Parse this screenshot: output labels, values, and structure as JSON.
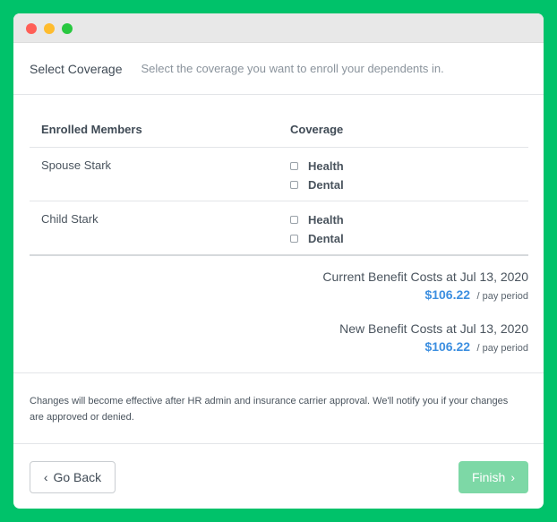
{
  "header": {
    "title": "Select Coverage",
    "subtitle": "Select the coverage you want to enroll your dependents in."
  },
  "table": {
    "headers": [
      "Enrolled Members",
      "Coverage"
    ],
    "rows": [
      {
        "member": "Spouse Stark",
        "options": [
          {
            "label": "Health",
            "checked": false
          },
          {
            "label": "Dental",
            "checked": false
          }
        ]
      },
      {
        "member": "Child Stark",
        "options": [
          {
            "label": "Health",
            "checked": false
          },
          {
            "label": "Dental",
            "checked": false
          }
        ]
      }
    ]
  },
  "costs": {
    "current_label": "Current Benefit Costs at Jul 13, 2020",
    "current_amount": "$106.22",
    "current_period": "/ pay period",
    "new_label": "New Benefit Costs at Jul 13, 2020",
    "new_amount": "$106.22",
    "new_period": "/ pay period"
  },
  "notice": "Changes will become effective after HR admin and insurance carrier approval. We'll notify you if your changes are approved or denied.",
  "buttons": {
    "back_label": "Go Back",
    "back_icon": "‹",
    "finish_label": "Finish",
    "finish_icon": "›"
  },
  "colors": {
    "background": "#00c26a",
    "accent_amount": "#3d8fe0",
    "finish_button": "#7dd8a6"
  }
}
